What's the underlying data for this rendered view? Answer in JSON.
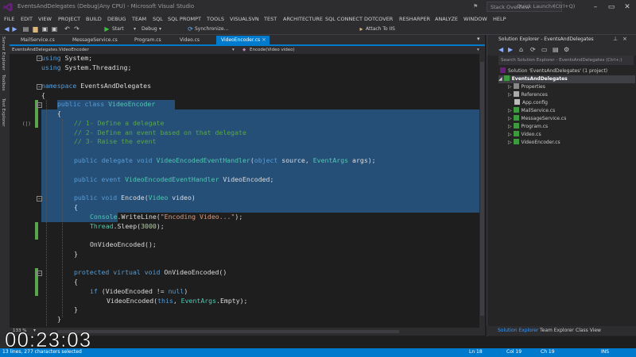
{
  "window": {
    "title": "EventsAndDelegates (Debug|Any CPU) - Microsoft Visual Studio",
    "quick_launch_placeholder": "Quick Launch (Ctrl+Q)",
    "stack_overflow": "Stack Overflow"
  },
  "menu": [
    "FILE",
    "EDIT",
    "VIEW",
    "PROJECT",
    "BUILD",
    "DEBUG",
    "TEAM",
    "SQL",
    "SQL PROMPT",
    "TOOLS",
    "VISUALSVN",
    "TEST",
    "ARCHITECTURE",
    "SQL CONNECT",
    "DOTCOVER",
    "RESHARPER",
    "ANALYZE",
    "WINDOW",
    "HELP"
  ],
  "toolbar": {
    "start": "Start",
    "config": "Debug",
    "synchronize": "Synchronize...",
    "attach": "Attach To IIS"
  },
  "left_tabs": [
    "Server Explorer",
    "Toolbox",
    "Test Explorer"
  ],
  "tabs": [
    "MailService.cs",
    "MessageService.cs",
    "Program.cs",
    "Video.cs",
    "VideoEncoder.cs"
  ],
  "nav": {
    "left": "EventsAndDelegates.VideoEncoder",
    "right": "Encode(Video video)"
  },
  "code": {
    "l1": [
      "using",
      " System;"
    ],
    "l2": [
      "using",
      " System.Threading;"
    ],
    "l4": [
      "namespace",
      " EventsAndDelegates"
    ],
    "l5": "{",
    "l6": [
      "public class",
      " ",
      "VideoEncoder"
    ],
    "l7": "{",
    "c1": "// 1- Define a delegate",
    "c2": "// 2- Define an event based on that delegate",
    "c3": "// 3- Raise the event",
    "d1": [
      "public delegate void",
      " ",
      "VideoEncodedEventHandler",
      "(",
      "object",
      " source, ",
      "EventArgs",
      " args);"
    ],
    "e1": [
      "public event",
      " ",
      "VideoEncodedEventHandler",
      " VideoEncoded;"
    ],
    "m1": [
      "public void",
      " Encode(",
      "Video",
      " video)"
    ],
    "m2": "{",
    "m3": [
      "Console",
      ".WriteLine(",
      "\"Encoding Video...\"",
      ");"
    ],
    "m4": [
      "Thread",
      ".Sleep(",
      "3000",
      ");"
    ],
    "m5": "OnVideoEncoded();",
    "m6": "}",
    "p1": [
      "protected virtual void",
      " OnVideoEncoded()"
    ],
    "p2": "{",
    "p3": [
      "if",
      " (VideoEncoded != ",
      "null",
      ")"
    ],
    "p4": [
      "VideoEncoded(",
      "this",
      ", ",
      "EventArgs",
      ".Empty);"
    ],
    "p5": "}",
    "p6": "}"
  },
  "zoom": "133 %",
  "solution_explorer": {
    "title": "Solution Explorer - EventsAndDelegates",
    "search_placeholder": "Search Solution Explorer - EventsAndDelegates (Ctrl+;)",
    "items": [
      {
        "label": "Solution 'EventsAndDelegates' (1 project)"
      },
      {
        "label": "EventsAndDelegates"
      },
      {
        "label": "Properties"
      },
      {
        "label": "References"
      },
      {
        "label": "App.config"
      },
      {
        "label": "MailService.cs"
      },
      {
        "label": "MessageService.cs"
      },
      {
        "label": "Program.cs"
      },
      {
        "label": "Video.cs"
      },
      {
        "label": "VideoEncoder.cs"
      }
    ],
    "bottom_tabs": [
      "Solution Explorer",
      "Team Explorer",
      "Class View"
    ]
  },
  "status": {
    "left": "13 lines, 277 characters selected",
    "ln": "Ln 18",
    "col": "Col 19",
    "ch": "Ch 19",
    "ins": "INS"
  },
  "timestamp": "00:23:03",
  "colors": {
    "accent": "#007acc",
    "keyword": "#569cd6",
    "type": "#4ec9b0",
    "comment": "#57a64a",
    "string": "#d69d85",
    "selection": "#264f78"
  }
}
